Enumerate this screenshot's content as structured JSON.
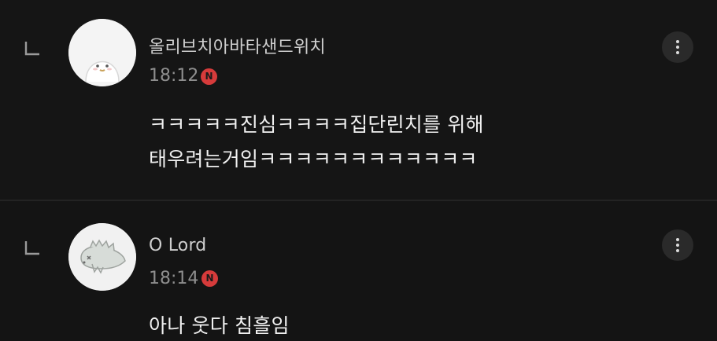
{
  "comments": [
    {
      "author": "올리브치아바타샌드위치",
      "time": "18:12",
      "badge_letter": "N",
      "text_lines": [
        "ㅋㅋㅋㅋㅋ진심ㅋㅋㅋㅋ집단린치를 위해",
        "태우려는거임ㅋㅋㅋㅋㅋㅋㅋㅋㅋㅋㅋㅋ"
      ],
      "avatar_icon": "smiling-character-avatar",
      "more_icon": "more-vertical-icon",
      "reply_icon": "reply-arrow-icon"
    },
    {
      "author": "O Lord",
      "time": "18:14",
      "badge_letter": "N",
      "text_lines": [
        "아나 웃다 침흘임"
      ],
      "avatar_icon": "dinosaur-character-avatar",
      "more_icon": "more-vertical-icon",
      "reply_icon": "reply-arrow-icon"
    }
  ],
  "colors": {
    "background": "#0e0e0e",
    "text": "#f0f0f0",
    "author": "#cfcfcf",
    "time": "#8e8e8e",
    "badge": "#d63b3b"
  }
}
